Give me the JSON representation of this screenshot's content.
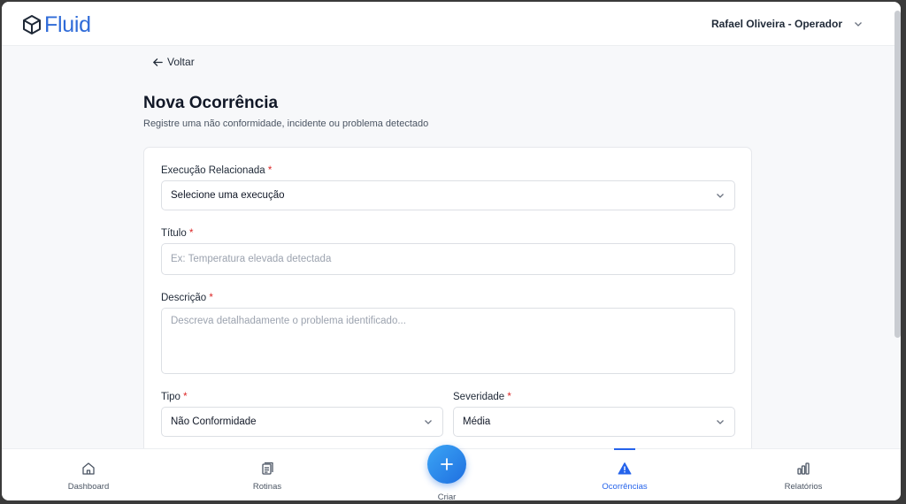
{
  "app": {
    "logo_text": "Fluid",
    "brand_color": "#2f6bd8",
    "user_label": "Rafael Oliveira - Operador"
  },
  "page": {
    "back_label": "Voltar",
    "title": "Nova Ocorrência",
    "subtitle": "Registre uma não conformidade, incidente ou problema detectado"
  },
  "form": {
    "execucao": {
      "label": "Execução Relacionada",
      "required_mark": "*",
      "value": "Selecione uma execução"
    },
    "titulo": {
      "label": "Título",
      "required_mark": "*",
      "placeholder": "Ex: Temperatura elevada detectada",
      "value": ""
    },
    "descricao": {
      "label": "Descrição",
      "required_mark": "*",
      "placeholder": "Descreva detalhadamente o problema identificado...",
      "value": ""
    },
    "tipo": {
      "label": "Tipo",
      "required_mark": "*",
      "value": "Não Conformidade"
    },
    "severidade": {
      "label": "Severidade",
      "required_mark": "*",
      "value": "Média"
    }
  },
  "nav": {
    "items": [
      {
        "label": "Dashboard",
        "icon": "home-icon"
      },
      {
        "label": "Rotinas",
        "icon": "clipboard-icon"
      },
      {
        "label": "Ocorrências",
        "icon": "alert-triangle-icon",
        "active": true
      },
      {
        "label": "Relatórios",
        "icon": "bar-chart-icon"
      }
    ],
    "create_label": "Criar",
    "active_color": "#2563eb"
  }
}
